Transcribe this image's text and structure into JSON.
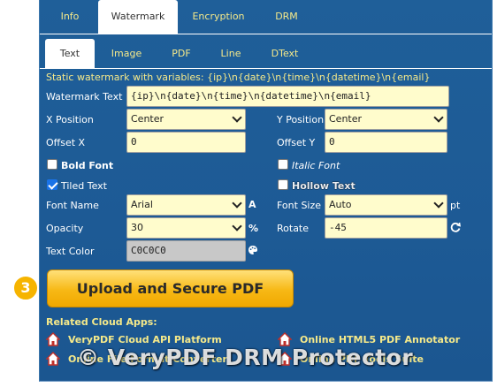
{
  "top_tabs": [
    {
      "label": "Info",
      "active": false
    },
    {
      "label": "Watermark",
      "active": true
    },
    {
      "label": "Encryption",
      "active": false
    },
    {
      "label": "DRM",
      "active": false
    }
  ],
  "sub_tabs": [
    {
      "label": "Text",
      "active": true
    },
    {
      "label": "Image",
      "active": false
    },
    {
      "label": "PDF",
      "active": false
    },
    {
      "label": "Line",
      "active": false
    },
    {
      "label": "DText",
      "active": false
    }
  ],
  "static_note": "Static watermark with variables: {ip}\\n{date}\\n{time}\\n{datetime}\\n{email}",
  "form": {
    "watermark_text_label": "Watermark Text",
    "watermark_text_value": "{ip}\\n{date}\\n{time}\\n{datetime}\\n{email}",
    "x_position_label": "X Position",
    "x_position_value": "Center",
    "y_position_label": "Y Position",
    "y_position_value": "Center",
    "offset_x_label": "Offset X",
    "offset_x_value": "0",
    "offset_y_label": "Offset Y",
    "offset_y_value": "0",
    "bold_font_label": "Bold Font",
    "bold_font_checked": false,
    "italic_font_label": "Italic Font",
    "italic_font_checked": false,
    "tiled_text_label": "Tiled Text",
    "tiled_text_checked": true,
    "hollow_text_label": "Hollow Text",
    "hollow_text_checked": false,
    "font_name_label": "Font Name",
    "font_name_value": "Arial",
    "font_name_suffix": "A",
    "font_size_label": "Font Size",
    "font_size_value": "Auto",
    "font_size_unit": "pt",
    "opacity_label": "Opacity",
    "opacity_value": "30",
    "opacity_unit": "%",
    "rotate_label": "Rotate",
    "rotate_value": "-45",
    "text_color_label": "Text Color",
    "text_color_value": "C0C0C0"
  },
  "upload": {
    "step": "3",
    "label": "Upload and Secure PDF"
  },
  "related": {
    "title": "Related Cloud Apps:",
    "apps": [
      "VeryPDF Cloud API Platform",
      "Online HTML5 PDF Annotator",
      "Online File Format Converter",
      "Online PDF Tools Suite"
    ]
  },
  "overlay_watermark": "© VeryPDF DRM Protector",
  "colors": {
    "panel_bg": "#1f5f99",
    "accent_yellow": "#f5e98a",
    "field_bg": "#fffccc",
    "button_orange": "#f7b815"
  }
}
